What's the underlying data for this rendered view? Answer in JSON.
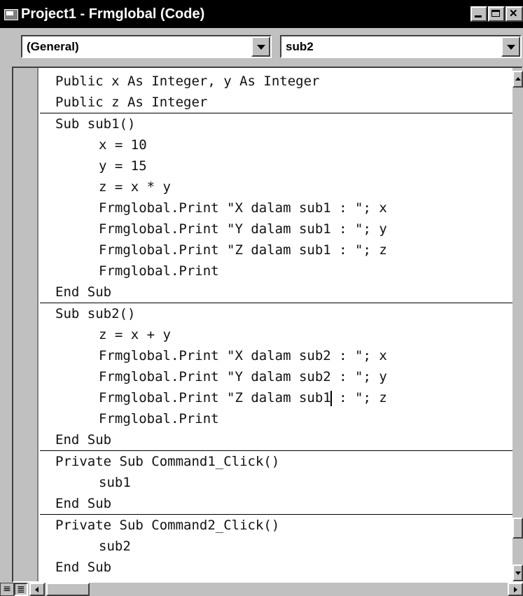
{
  "window": {
    "title": "Project1 - Frmglobal (Code)"
  },
  "combos": {
    "object": "(General)",
    "procedure": "sub2"
  },
  "icons": [
    "window-icon",
    "minimize-icon",
    "maximize-icon",
    "close-icon",
    "dropdown-arrow-icon",
    "scroll-up-icon",
    "scroll-down-icon",
    "scroll-left-icon",
    "scroll-right-icon",
    "procedure-view-icon",
    "full-module-view-icon"
  ],
  "code": {
    "blocks": [
      [
        "Public x As Integer, y As Integer",
        "Public z As Integer"
      ],
      [
        "Sub sub1()",
        "x = 10",
        "y = 15",
        "z = x * y",
        "Frmglobal.Print \"X dalam sub1 : \"; x",
        "Frmglobal.Print \"Y dalam sub1 : \"; y",
        "Frmglobal.Print \"Z dalam sub1 : \"; z",
        "Frmglobal.Print",
        "End Sub"
      ],
      [
        "Sub sub2()",
        "z = x + y",
        "Frmglobal.Print \"X dalam sub2 : \"; x",
        "Frmglobal.Print \"Y dalam sub2 : \"; y",
        "Frmglobal.Print \"Z dalam sub1 : \"; z",
        "Frmglobal.Print",
        "End Sub"
      ],
      [
        "Private Sub Command1_Click()",
        "sub1",
        "End Sub"
      ],
      [
        "Private Sub Command2_Click()",
        "sub2",
        "End Sub"
      ]
    ]
  }
}
